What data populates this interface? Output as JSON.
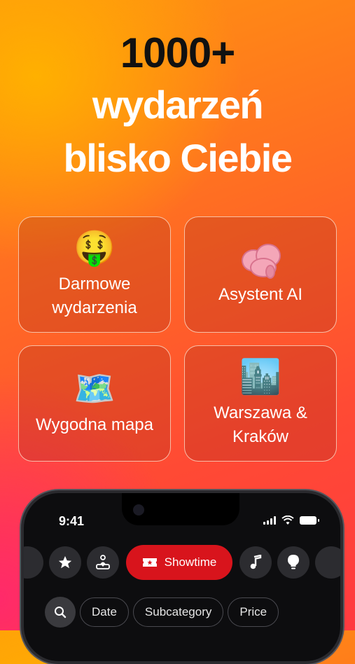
{
  "hero": {
    "line1": "1000+",
    "line2": "wydarzeń",
    "line3": "blisko Ciebie"
  },
  "features": [
    {
      "icon": "money-mouth-face-icon",
      "emoji": "🤑",
      "label": "Darmowe wydarzenia"
    },
    {
      "icon": "brain-icon",
      "label": "Asystent AI"
    },
    {
      "icon": "world-map-icon",
      "emoji": "🗺️",
      "label": "Wygodna mapa"
    },
    {
      "icon": "cityscape-icon",
      "emoji": "🏙️",
      "label": "Warszawa & Kraków"
    }
  ],
  "phone": {
    "status": {
      "time": "9:41"
    },
    "categories": [
      {
        "icon": "star-icon"
      },
      {
        "icon": "people-heart-icon"
      },
      {
        "icon": "ticket-icon",
        "label": "Showtime",
        "active": true
      },
      {
        "icon": "music-note-icon"
      },
      {
        "icon": "lightbulb-icon"
      }
    ],
    "filters": [
      "Date",
      "Subcategory",
      "Price"
    ]
  },
  "colors": {
    "accent": "#d8141c",
    "chip_border": "#4a4a50"
  }
}
